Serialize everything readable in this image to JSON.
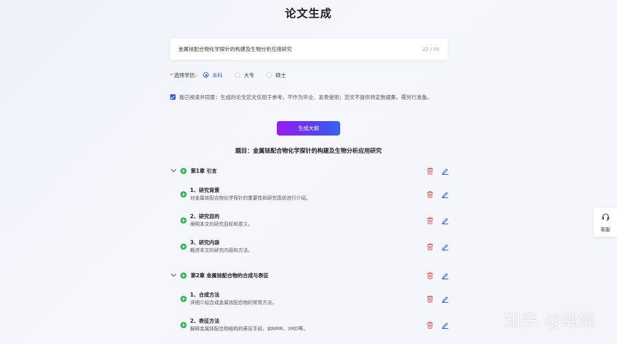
{
  "page": {
    "title": "论文生成"
  },
  "topic": {
    "value": "金属铱配合物化学探针的构建及生物分析应用研究",
    "count": "22 / 50"
  },
  "education": {
    "required_mark": "*",
    "label": "选择学历:",
    "options": [
      {
        "label": "本科",
        "checked": true
      },
      {
        "label": "大专",
        "checked": false
      },
      {
        "label": "硕士",
        "checked": false
      }
    ]
  },
  "agreement": {
    "text": "我已阅读并同意：生成的论文范文仅用于参考，不作为毕业、发表使用；范文不提供特定数据集，需另行准备。",
    "checked": true
  },
  "generate_button": {
    "label": "生成大纲"
  },
  "subject": {
    "text": "题目：金属铱配合物化学探针的构建及生物分析应用研究"
  },
  "outline": {
    "chapters": [
      {
        "title": "第1章 引言",
        "sections": [
          {
            "title": "1、研究背景",
            "desc": "对金属铱配合物化学探针的重要性和研究现状进行介绍。"
          },
          {
            "title": "2、研究目的",
            "desc": "阐明本文的研究目标和意义。"
          },
          {
            "title": "3、研究内容",
            "desc": "概述本文的研究内容和方法。"
          }
        ]
      },
      {
        "title": "第2章 金属铱配合物的合成与表征",
        "sections": [
          {
            "title": "1、合成方法",
            "desc": "详细介绍合成金属铱配合物的常用方法。"
          },
          {
            "title": "2、表征方法",
            "desc": "解释金属铱配合物结构的表征手段，如NMR、XRD等。"
          }
        ]
      }
    ]
  },
  "service": {
    "label": "客服"
  },
  "watermark": {
    "text": "知乎 @绵绵"
  },
  "colors": {
    "accent": "#2f5fe8",
    "add_green": "#2fb34a",
    "delete_red": "#e64a4a",
    "edit_blue": "#2f5fe8"
  },
  "icons": {
    "chevron": "chevron-down-icon",
    "add": "plus-circle-icon",
    "delete": "trash-icon",
    "edit": "pencil-icon",
    "service": "headset-icon"
  }
}
